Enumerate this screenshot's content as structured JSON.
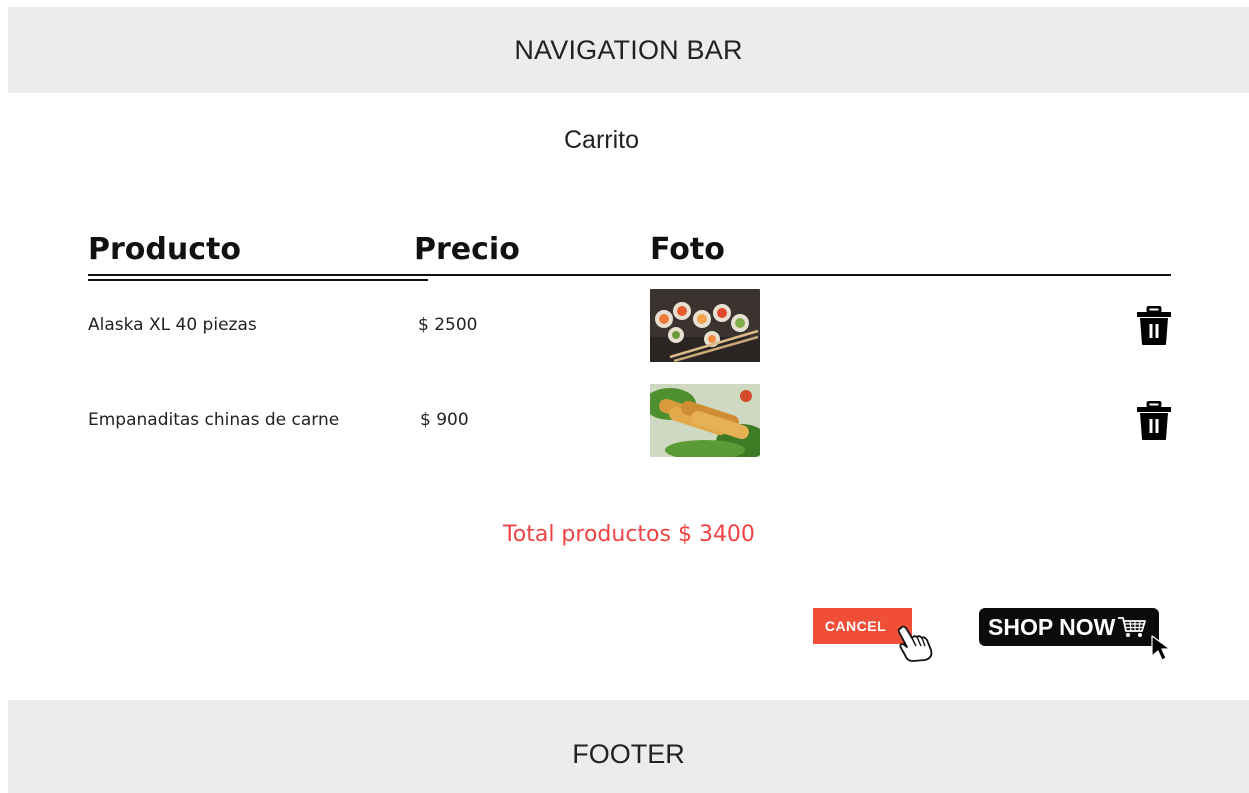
{
  "navbar": {
    "label": "NAVIGATION BAR"
  },
  "page": {
    "title": "Carrito"
  },
  "table": {
    "headers": [
      "Producto",
      "Precio",
      "Foto"
    ],
    "rows": [
      {
        "product": "Alaska XL 40 piezas",
        "price": "$ 2500",
        "photo": "sushi-photo"
      },
      {
        "product": "Empanaditas chinas de carne",
        "price": "$ 900",
        "photo": "spring-rolls-photo"
      }
    ]
  },
  "total": {
    "label": "Total productos $ 3400"
  },
  "actions": {
    "cancel_label": "CANCEL",
    "shop_label": "SHOP NOW"
  },
  "footer": {
    "label": "FOOTER"
  },
  "colors": {
    "accent": "#f04e37",
    "total_text": "#ee4444",
    "bar_bg": "#ececec",
    "shop_bg": "#0b0b0b"
  },
  "icons": {
    "delete": "trash-icon",
    "cart": "cart-icon",
    "hand": "hand-pointer-icon",
    "arrow": "arrow-cursor-icon"
  }
}
